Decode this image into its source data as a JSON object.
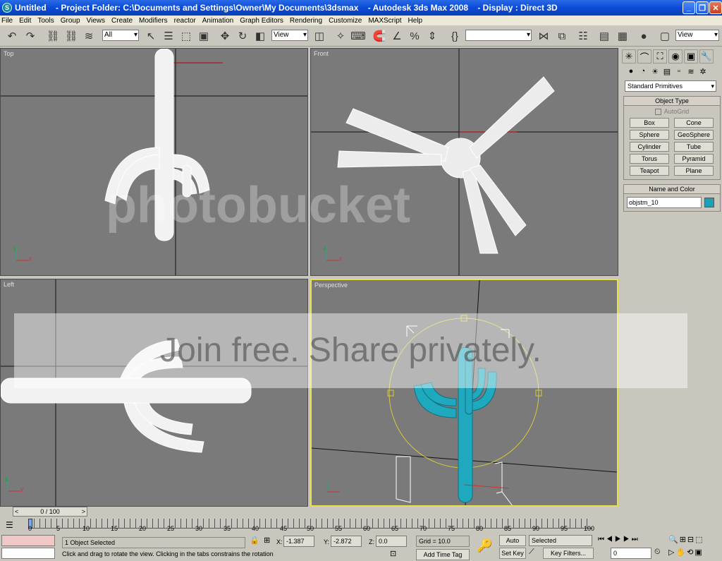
{
  "window": {
    "title": "Untitled    - Project Folder: C:\\Documents and Settings\\Owner\\My Documents\\3dsmax    - Autodesk 3ds Max 2008    - Display : Direct 3D"
  },
  "menu": [
    "File",
    "Edit",
    "Tools",
    "Group",
    "Views",
    "Create",
    "Modifiers",
    "reactor",
    "Animation",
    "Graph Editors",
    "Rendering",
    "Customize",
    "MAXScript",
    "Help"
  ],
  "toolbar": {
    "selection_filter": "All",
    "ref_coord": "View",
    "named_selection": "",
    "view_dropdown": "View"
  },
  "viewports": {
    "top": "Top",
    "front": "Front",
    "left": "Left",
    "perspective": "Perspective"
  },
  "command_panel": {
    "category": "Standard Primitives",
    "object_type_title": "Object Type",
    "autogrid": "AutoGrid",
    "buttons": [
      "Box",
      "Cone",
      "Sphere",
      "GeoSphere",
      "Cylinder",
      "Tube",
      "Torus",
      "Pyramid",
      "Teapot",
      "Plane"
    ],
    "name_color_title": "Name and Color",
    "object_name": "objstm_10",
    "object_color": "#1ea0b4"
  },
  "time": {
    "slider": "0 / 100",
    "prev": "<",
    "next": ">",
    "ticks": [
      "0",
      "5",
      "10",
      "15",
      "20",
      "25",
      "30",
      "35",
      "40",
      "45",
      "50",
      "55",
      "60",
      "65",
      "70",
      "75",
      "80",
      "85",
      "90",
      "95",
      "100"
    ]
  },
  "status": {
    "selection": "1 Object Selected",
    "prompt": "Click and drag to rotate the view.  Clicking in the tabs constrains the rotation",
    "x_label": "X:",
    "x_value": "-1.387",
    "y_label": "Y:",
    "y_value": "-2.872",
    "z_label": "Z:",
    "z_value": "0.0",
    "grid": "Grid = 10.0",
    "add_time_tag": "Add Time Tag",
    "auto_key": "Auto Key",
    "auto_key_mode": "Selected",
    "set_key": "Set Key",
    "key_filters": "Key Filters...",
    "frame": "0"
  },
  "watermark": {
    "brand": "photobucket",
    "tagline": "Join free. Share privately."
  }
}
